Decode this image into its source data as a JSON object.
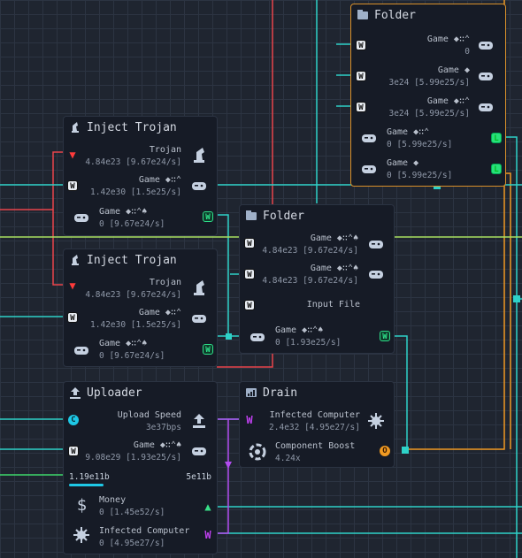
{
  "colors": {
    "red": "#e8454a",
    "orange": "#f09a22",
    "teal": "#2ed2c8",
    "green": "#3ed86a",
    "purple": "#b24cf0",
    "cyan": "#1ec8e6",
    "lime": "#a8e060"
  },
  "folder_top": {
    "title": "Folder",
    "rows": [
      {
        "label": "Game ◆∷⌃",
        "value": "0"
      },
      {
        "label": "Game ◆",
        "value": "3e24 [5.99e25/s]"
      },
      {
        "label": "Game ◆∷⌃",
        "value": "3e24 [5.99e25/s]"
      },
      {
        "label": "Game ◆∷⌃",
        "value": "0 [5.99e25/s]"
      },
      {
        "label": "Game ◆",
        "value": "0 [5.99e25/s]"
      }
    ]
  },
  "inject1": {
    "title": "Inject Trojan",
    "rows": [
      {
        "label": "Trojan",
        "value": "4.84e23 [9.67e24/s]"
      },
      {
        "label": "Game ◆∷⌃",
        "value": "1.42e30 [1.5e25/s]"
      },
      {
        "label": "Game ◆∷⌃♠",
        "value": "0 [9.67e24/s]"
      }
    ]
  },
  "inject2": {
    "title": "Inject Trojan",
    "rows": [
      {
        "label": "Trojan",
        "value": "4.84e23 [9.67e24/s]"
      },
      {
        "label": "Game ◆∷⌃",
        "value": "1.42e30 [1.5e25/s]"
      },
      {
        "label": "Game ◆∷⌃♠",
        "value": "0 [9.67e24/s]"
      }
    ]
  },
  "folder_mid": {
    "title": "Folder",
    "rows": [
      {
        "label": "Game ◆∷⌃♠",
        "value": "4.84e23 [9.67e24/s]"
      },
      {
        "label": "Game ◆∷⌃♠",
        "value": "4.84e23 [9.67e24/s]"
      },
      {
        "label": "Input File",
        "value": ""
      },
      {
        "label": "Game ◆∷⌃♠",
        "value": "0 [1.93e25/s]"
      }
    ]
  },
  "uploader": {
    "title": "Uploader",
    "rows": [
      {
        "label": "Upload Speed",
        "value": "3e37bps"
      },
      {
        "label": "Game ◆∷⌃♠",
        "value": "9.08e29 [1.93e25/s]"
      }
    ],
    "progress": {
      "left": "1.19e11b",
      "right": "5e11b",
      "fraction": 0.24
    },
    "outputs": [
      {
        "label": "Money",
        "value": "0 [1.45e52/s]"
      },
      {
        "label": "Infected Computer",
        "value": "0 [4.95e27/s]"
      }
    ]
  },
  "drain": {
    "title": "Drain",
    "rows": [
      {
        "label": "Infected Computer",
        "value": "2.4e32 [4.95e27/s]"
      },
      {
        "label": "Component Boost",
        "value": "4.24x"
      }
    ]
  }
}
